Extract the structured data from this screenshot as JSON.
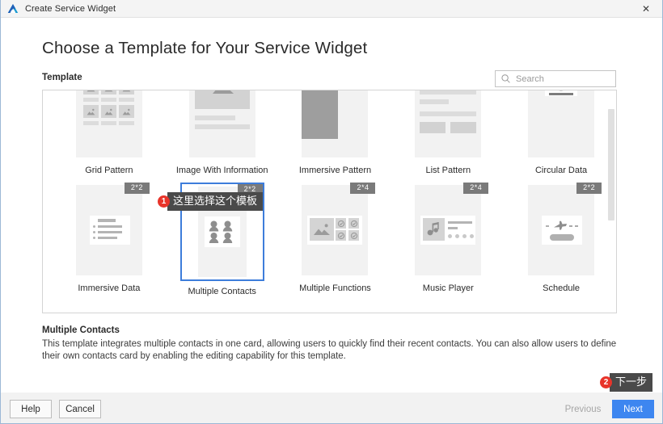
{
  "window": {
    "title": "Create Service Widget",
    "app_icon": "deveco-logo-icon",
    "close_label": "✕",
    "accent_color": "#3d86f0",
    "selection_color": "#3d7ddb",
    "annotation_color": "#e8342a"
  },
  "dialog": {
    "heading": "Choose a Template for Your Service Widget",
    "section_label": "Template"
  },
  "search": {
    "placeholder": "Search",
    "value": "",
    "icon": "search-icon"
  },
  "templates": {
    "rows": [
      [
        {
          "name": "Grid Pattern",
          "badge": "",
          "thumb": "grid-pattern"
        },
        {
          "name": "Image With Information",
          "badge": "",
          "thumb": "image-with-information"
        },
        {
          "name": "Immersive Pattern",
          "badge": "",
          "thumb": "immersive-pattern"
        },
        {
          "name": "List Pattern",
          "badge": "",
          "thumb": "list-pattern"
        },
        {
          "name": "Circular Data",
          "badge": "",
          "thumb": "circular-data"
        }
      ],
      [
        {
          "name": "Immersive Data",
          "badge": "2*2",
          "thumb": "immersive-data"
        },
        {
          "name": "Multiple Contacts",
          "badge": "2*2",
          "thumb": "multiple-contacts",
          "selected": true
        },
        {
          "name": "Multiple Functions",
          "badge": "2*4",
          "thumb": "multiple-functions"
        },
        {
          "name": "Music Player",
          "badge": "2*4",
          "thumb": "music-player"
        },
        {
          "name": "Schedule",
          "badge": "2*2",
          "thumb": "schedule"
        }
      ]
    ]
  },
  "description": {
    "title": "Multiple Contacts",
    "text": "This template integrates multiple contacts in one card, allowing users to quickly find their recent contacts. You can also allow users to define their own contacts card by enabling the editing capability for this template."
  },
  "annotations": [
    {
      "number": "1",
      "text": "这里选择这个模板"
    },
    {
      "number": "2",
      "text": "下一步"
    }
  ],
  "footer": {
    "help": "Help",
    "cancel": "Cancel",
    "previous": "Previous",
    "next": "Next"
  }
}
